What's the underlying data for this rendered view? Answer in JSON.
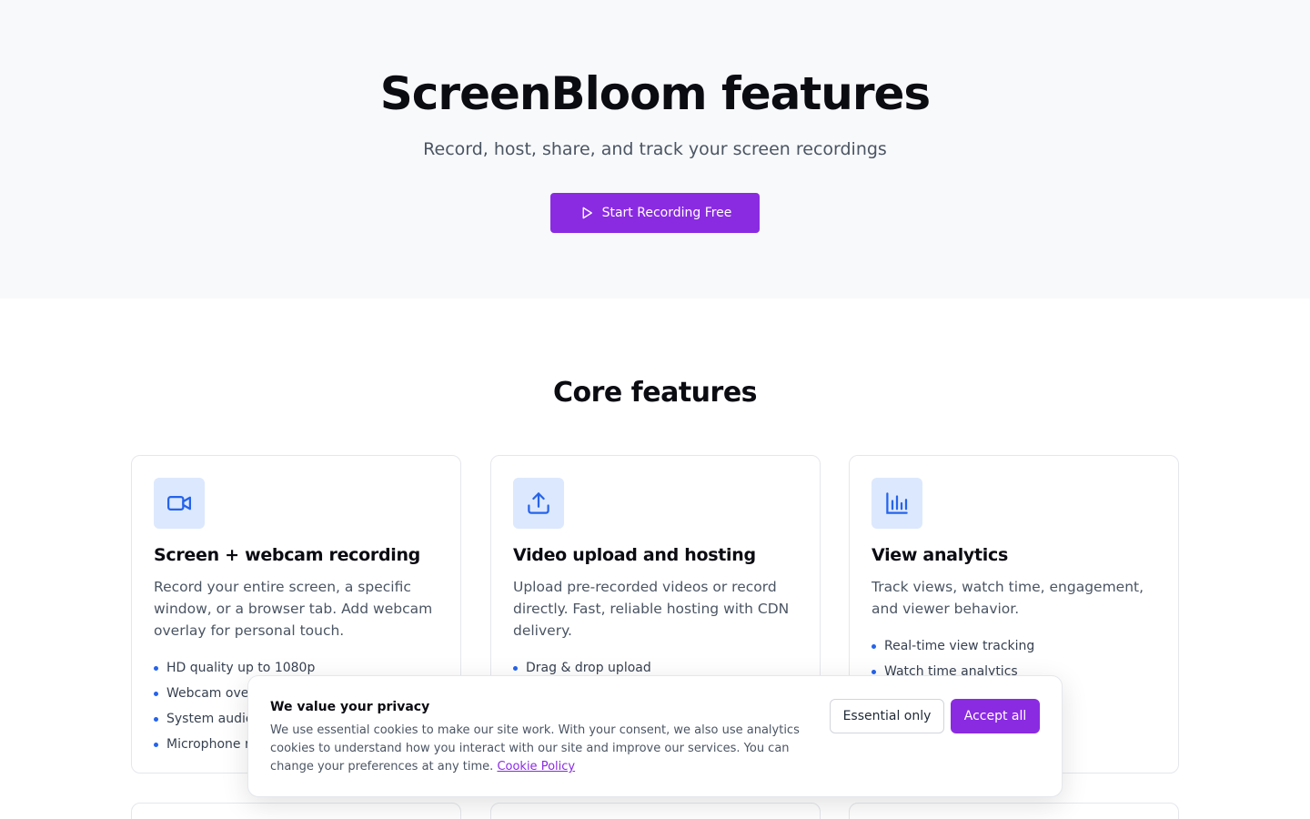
{
  "hero": {
    "title": "ScreenBloom features",
    "subtitle": "Record, host, share, and track your screen recordings",
    "cta_label": "Start Recording Free",
    "cta_icon": "play-icon"
  },
  "core": {
    "title": "Core features",
    "cards": [
      {
        "icon": "video-camera-icon",
        "title": "Screen + webcam recording",
        "description": "Record your entire screen, a specific window, or a browser tab. Add webcam overlay for personal touch.",
        "bullets": [
          "HD quality up to 1080p",
          "Webcam overl",
          "System audio",
          "Microphone r"
        ]
      },
      {
        "icon": "upload-icon",
        "title": "Video upload and hosting",
        "description": "Upload pre-recorded videos or record directly. Fast, reliable hosting with CDN delivery.",
        "bullets": [
          "Drag & drop upload"
        ]
      },
      {
        "icon": "bar-chart-icon",
        "title": "View analytics",
        "description": "Track views, watch time, engagement, and viewer behavior.",
        "bullets": [
          "Real-time view tracking",
          "Watch time analytics"
        ]
      }
    ]
  },
  "cookie": {
    "title": "We value your privacy",
    "text": "We use essential cookies to make our site work. With your consent, we also use analytics cookies to understand how you interact with our site and improve our services. You can change your preferences at any time. ",
    "link_label": "Cookie Policy",
    "essential_label": "Essential only",
    "accept_label": "Accept all"
  },
  "colors": {
    "accent": "#8a2be2",
    "icon_blue": "#2563eb",
    "icon_bg": "#dce8fd",
    "hero_bg": "#f8f9fb"
  }
}
